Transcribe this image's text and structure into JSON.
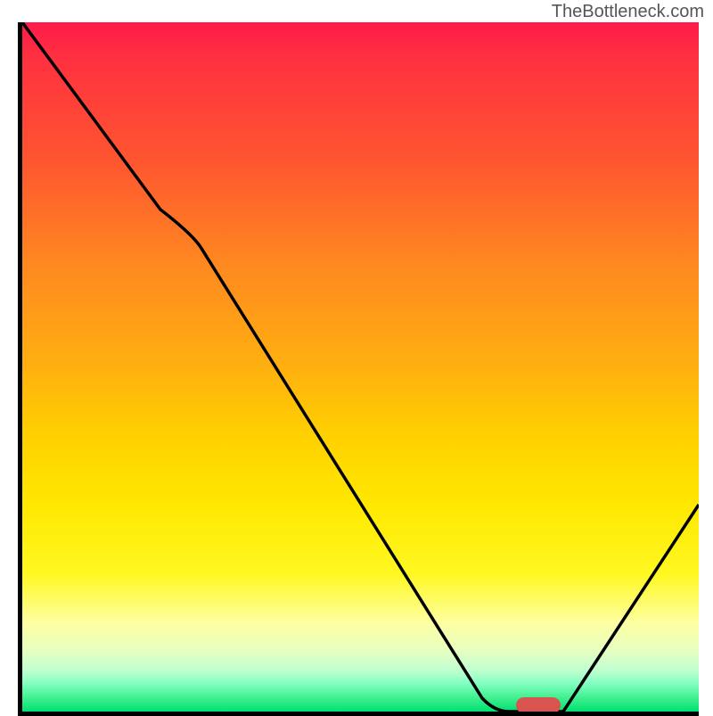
{
  "watermark": "TheBottleneck.com",
  "chart_data": {
    "type": "line",
    "title": "",
    "xlabel": "",
    "ylabel": "",
    "gradient_colors": {
      "top": "#ff1a4a",
      "middle": "#ffd000",
      "bottom": "#00e070"
    },
    "curve_points_normalized": [
      {
        "x": 0.0,
        "y": 1.0
      },
      {
        "x": 0.2,
        "y": 0.73
      },
      {
        "x": 0.26,
        "y": 0.705
      },
      {
        "x": 0.68,
        "y": 0.02
      },
      {
        "x": 0.72,
        "y": 0.0
      },
      {
        "x": 0.8,
        "y": 0.0
      },
      {
        "x": 1.0,
        "y": 0.3
      }
    ],
    "marker": {
      "x_normalized": 0.76,
      "y_normalized": 0.0,
      "color": "#d9534f"
    },
    "notes": "Bottleneck-style chart: vertical gradient from red (top) through orange/yellow to green (bottom). Black curve descends from upper-left, dips to bottom near x≈0.72–0.80, then rises toward right edge. Rounded red marker at the curve minimum near the bottom axis."
  }
}
